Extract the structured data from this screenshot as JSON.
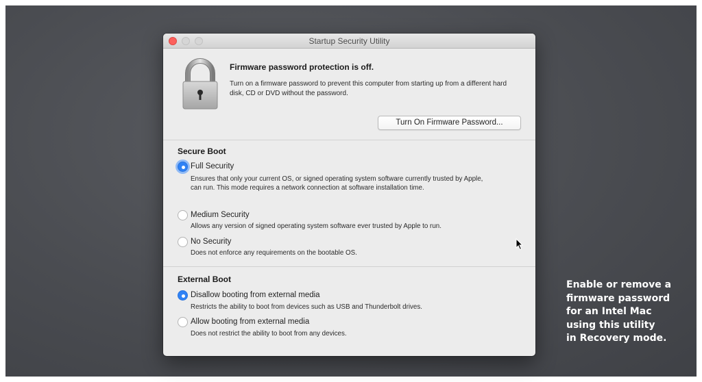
{
  "window": {
    "title": "Startup Security Utility",
    "controls": [
      "close",
      "minimize",
      "zoom"
    ]
  },
  "firmware": {
    "icon": "padlock-icon",
    "heading": "Firmware password protection is off.",
    "description": "Turn on a firmware password to prevent this computer from starting up from a different hard disk, CD or DVD without the password.",
    "button_label": "Turn On Firmware Password..."
  },
  "secure_boot": {
    "heading": "Secure Boot",
    "options": [
      {
        "label": "Full Security",
        "description": "Ensures that only your current OS, or signed operating system software currently trusted by Apple, can run. This mode requires a network connection at software installation time.",
        "selected": true
      },
      {
        "label": "Medium Security",
        "description": "Allows any version of signed operating system software ever trusted by Apple to run.",
        "selected": false
      },
      {
        "label": "No Security",
        "description": "Does not enforce any requirements on the bootable OS.",
        "selected": false
      }
    ]
  },
  "external_boot": {
    "heading": "External Boot",
    "options": [
      {
        "label": "Disallow booting from external media",
        "description": "Restricts the ability to boot from devices such as USB and Thunderbolt drives.",
        "selected": true
      },
      {
        "label": "Allow booting from external media",
        "description": "Does not restrict the ability to boot from any devices.",
        "selected": false
      }
    ]
  },
  "caption": {
    "lines": [
      "Enable or remove a",
      "firmware password",
      "for an Intel Mac",
      "using this utility",
      "in Recovery mode."
    ]
  },
  "colors": {
    "desktop": "#4d4f54",
    "window_bg": "#ececec",
    "accent": "#2f82f5",
    "close_button": "#fc605c"
  }
}
